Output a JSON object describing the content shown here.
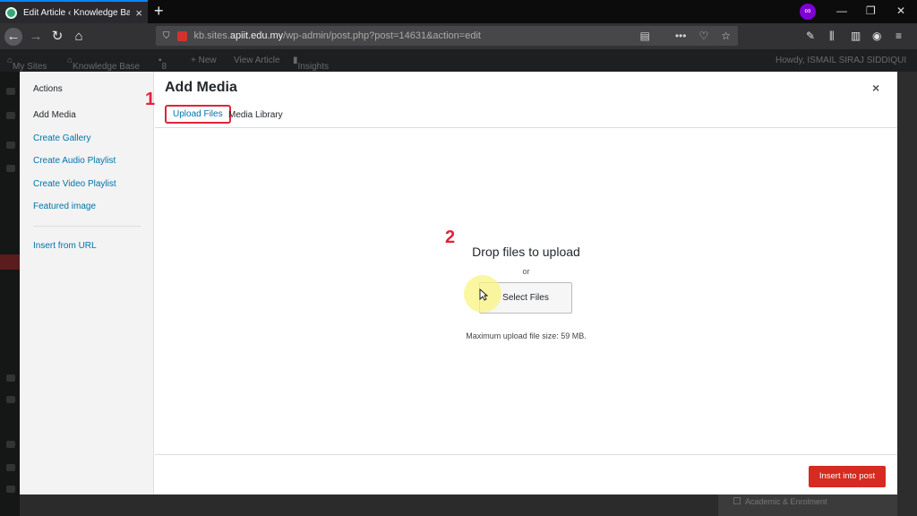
{
  "browser": {
    "tab_title": "Edit Article ‹ Knowledge Base",
    "tab_close": "×",
    "new_tab": "+",
    "url_domain_prefix": "kb.sites.",
    "url_domain": "apiit.edu.my",
    "url_path": "/wp-admin/post.php?post=14631&action=edit",
    "more_dots": "•••"
  },
  "adminbar": {
    "my_sites": "My Sites",
    "site_name": "Knowledge Base",
    "comments": "8",
    "new": "+ New",
    "view_article": "View Article",
    "insights": "Insights",
    "howdy": "Howdy, ISMAIL SIRAJ SIDDIQUI"
  },
  "modal": {
    "menu_heading": "Actions",
    "menu_items": [
      "Add Media",
      "Create Gallery",
      "Create Audio Playlist",
      "Create Video Playlist",
      "Featured image"
    ],
    "insert_from_url": "Insert from URL",
    "title": "Add Media",
    "close": "×",
    "tabs": [
      "Upload Files",
      "Media Library"
    ],
    "drop_title": "Drop files to upload",
    "or": "or",
    "select_files": "Select Files",
    "max_size": "Maximum upload file size: 59 MB.",
    "insert_button": "Insert into post"
  },
  "annotations": {
    "step1": "1",
    "step2": "2"
  },
  "background": {
    "category_label": "Academic & Enrolment"
  },
  "colors": {
    "accent_link": "#0073aa",
    "annotation_red": "#e0243a",
    "insert_button": "#d52b20"
  }
}
